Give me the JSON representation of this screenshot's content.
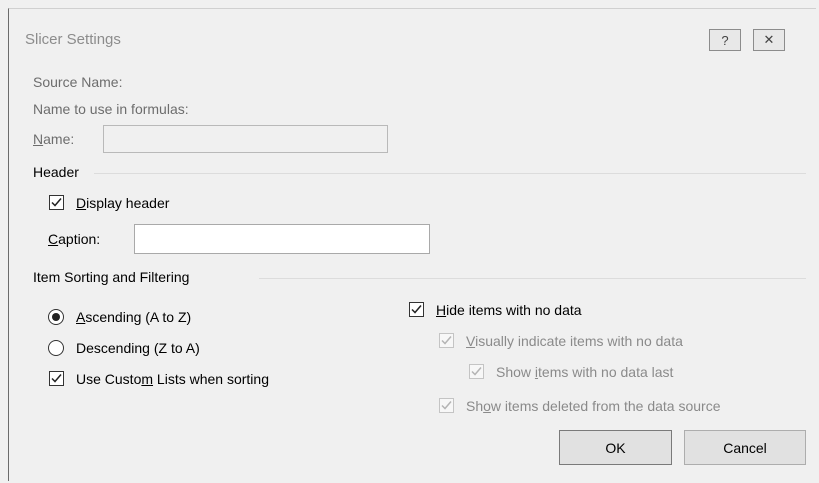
{
  "dialog": {
    "title": "Slicer Settings",
    "help_glyph": "?",
    "close_glyph": "✕"
  },
  "source": {
    "source_name_label": "Source Name:",
    "formula_name_label": "Name to use in formulas:",
    "name_label_underlined": "N",
    "name_label_rest": "ame:",
    "name_value": ""
  },
  "header": {
    "section_title": "Header",
    "display_header": {
      "pre": "",
      "ul": "D",
      "post": "isplay header",
      "checked": true
    },
    "caption_label_underlined": "C",
    "caption_label_rest": "aption:",
    "caption_value": ""
  },
  "sorting": {
    "section_title": "Item Sorting and Filtering",
    "ascending": {
      "pre": "",
      "ul": "A",
      "post": "scending (A to Z)",
      "selected": true
    },
    "descending": {
      "pre": "Descendin",
      "ul": "g",
      "post": " (Z to A)",
      "selected": false
    },
    "custom_lists": {
      "pre": "Use Custo",
      "ul": "m",
      "post": " Lists when sorting",
      "checked": true
    },
    "hide_no_data": {
      "pre": "",
      "ul": "H",
      "post": "ide items with no data",
      "checked": true
    },
    "visually_indicate": {
      "pre": "",
      "ul": "V",
      "post": "isually indicate items with no data",
      "checked": true,
      "enabled": false
    },
    "show_no_data_last": {
      "pre": "Show ",
      "ul": "i",
      "post": "tems with no data last",
      "checked": true,
      "enabled": false
    },
    "show_deleted": {
      "pre": "Sh",
      "ul": "o",
      "post": "w items deleted from the data source",
      "checked": true,
      "enabled": false
    }
  },
  "buttons": {
    "ok": "OK",
    "cancel": "Cancel"
  },
  "colors": {
    "dialog_bg": "#f0f0f0",
    "disabled_text": "#8a8a8a",
    "title_text": "#8c8c8c"
  }
}
